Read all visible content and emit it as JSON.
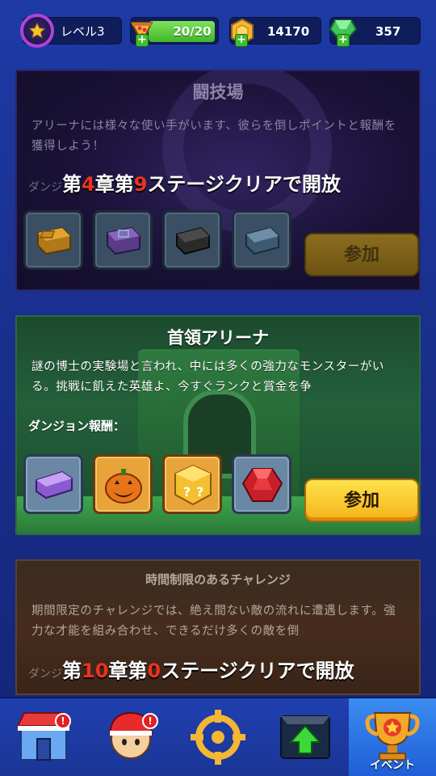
{
  "status": {
    "level_label": "レベル3",
    "energy_text": "20/20",
    "energy_fraction": 1.0,
    "gold": "14170",
    "gems": "357"
  },
  "arena": {
    "title": "闘技場",
    "description": "アリーナには様々な使い手がいます、彼らを倒しポイントと報酬を獲得しよう！",
    "unlock_prefix": "ダンジ",
    "unlock_part1": "第",
    "unlock_chapter": "4",
    "unlock_part2": "章第",
    "unlock_stage": "9",
    "unlock_part3": "ステージクリアで開放",
    "rewards": [
      "gold-ingot-icon",
      "purple-chest-icon",
      "black-ingot-icon",
      "blue-ingot-icon"
    ],
    "join_label": "参加"
  },
  "boss_arena": {
    "title": "首領アリーナ",
    "description": "謎の博士の実験場と言われ、中には多くの強力なモンスターがいる。挑戦に飢えた英雄よ、今すぐランクと賞金を争",
    "reward_label": "ダンジョン報酬：",
    "rewards": [
      "purple-ingot-icon",
      "pumpkin-icon",
      "mystery-box-icon",
      "ruby-icon"
    ],
    "join_label": "参加"
  },
  "timed_challenge": {
    "title": "時間制限のあるチャレンジ",
    "description": "期間限定のチャレンジでは、絶え間ない敵の流れに遭遇します。強力な才能を組み合わせ、できるだけ多くの敵を倒",
    "unlock_prefix": "ダンジ",
    "unlock_part1": "第",
    "unlock_chapter": "10",
    "unlock_part2": "章第",
    "unlock_stage": "0",
    "unlock_part3": "ステージクリアで開放"
  },
  "nav": {
    "items": [
      {
        "icon": "shop-icon",
        "badge": "!"
      },
      {
        "icon": "hero-icon",
        "badge": "!"
      },
      {
        "icon": "crosshair-icon"
      },
      {
        "icon": "upgrade-icon"
      },
      {
        "icon": "trophy-icon",
        "label": "イベント",
        "active": true
      }
    ]
  },
  "colors": {
    "background": "#1a2f8c",
    "highlight_red": "#e8341f",
    "join_button_active": "#f5b21a"
  }
}
